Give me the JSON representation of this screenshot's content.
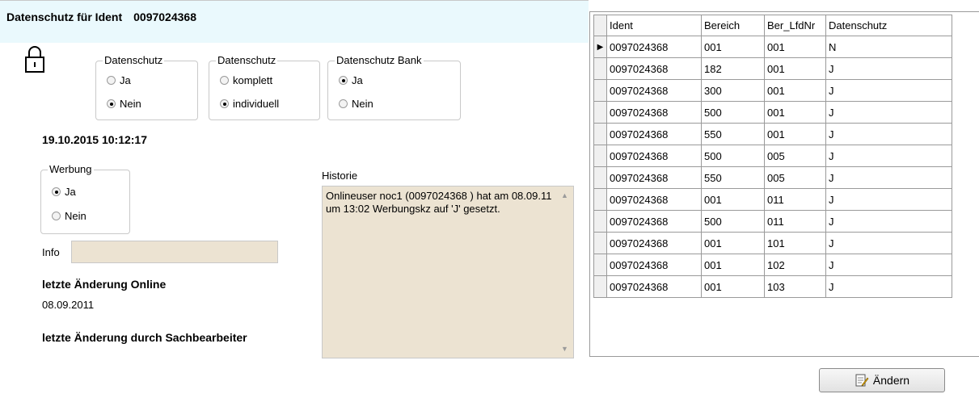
{
  "header": {
    "title": "Datenschutz für Ident",
    "ident": "0097024368"
  },
  "group_datenschutz": {
    "legend": "Datenschutz",
    "options": [
      "Ja",
      "Nein"
    ],
    "selected": "Nein"
  },
  "group_umfang": {
    "legend": "Datenschutz",
    "options": [
      "komplett",
      "individuell"
    ],
    "selected": "individuell"
  },
  "group_bank": {
    "legend": "Datenschutz Bank",
    "options": [
      "Ja",
      "Nein"
    ],
    "selected": "Ja"
  },
  "timestamp": "19.10.2015 10:12:17",
  "group_werbung": {
    "legend": "Werbung",
    "options": [
      "Ja",
      "Nein"
    ],
    "selected": "Ja"
  },
  "info": {
    "label": "Info",
    "value": ""
  },
  "historie": {
    "label": "Historie",
    "text": "Onlineuser noc1 (0097024368 ) hat am 08.09.11 um 13:02 Werbungskz auf 'J' gesetzt."
  },
  "last_online": {
    "label": "letzte Änderung Online",
    "value": "08.09.2011"
  },
  "last_clerk": {
    "label": "letzte Änderung durch Sachbearbeiter",
    "value": ""
  },
  "grid": {
    "columns": [
      "Ident",
      "Bereich",
      "Ber_LfdNr",
      "Datenschutz"
    ],
    "rows": [
      [
        "0097024368",
        "001",
        "001",
        "N"
      ],
      [
        "0097024368",
        "182",
        "001",
        "J"
      ],
      [
        "0097024368",
        "300",
        "001",
        "J"
      ],
      [
        "0097024368",
        "500",
        "001",
        "J"
      ],
      [
        "0097024368",
        "550",
        "001",
        "J"
      ],
      [
        "0097024368",
        "500",
        "005",
        "J"
      ],
      [
        "0097024368",
        "550",
        "005",
        "J"
      ],
      [
        "0097024368",
        "001",
        "011",
        "J"
      ],
      [
        "0097024368",
        "500",
        "011",
        "J"
      ],
      [
        "0097024368",
        "001",
        "101",
        "J"
      ],
      [
        "0097024368",
        "001",
        "102",
        "J"
      ],
      [
        "0097024368",
        "001",
        "103",
        "J"
      ]
    ],
    "current_row": 0
  },
  "button": {
    "label": "Ändern",
    "icon": "edit-document-icon"
  }
}
